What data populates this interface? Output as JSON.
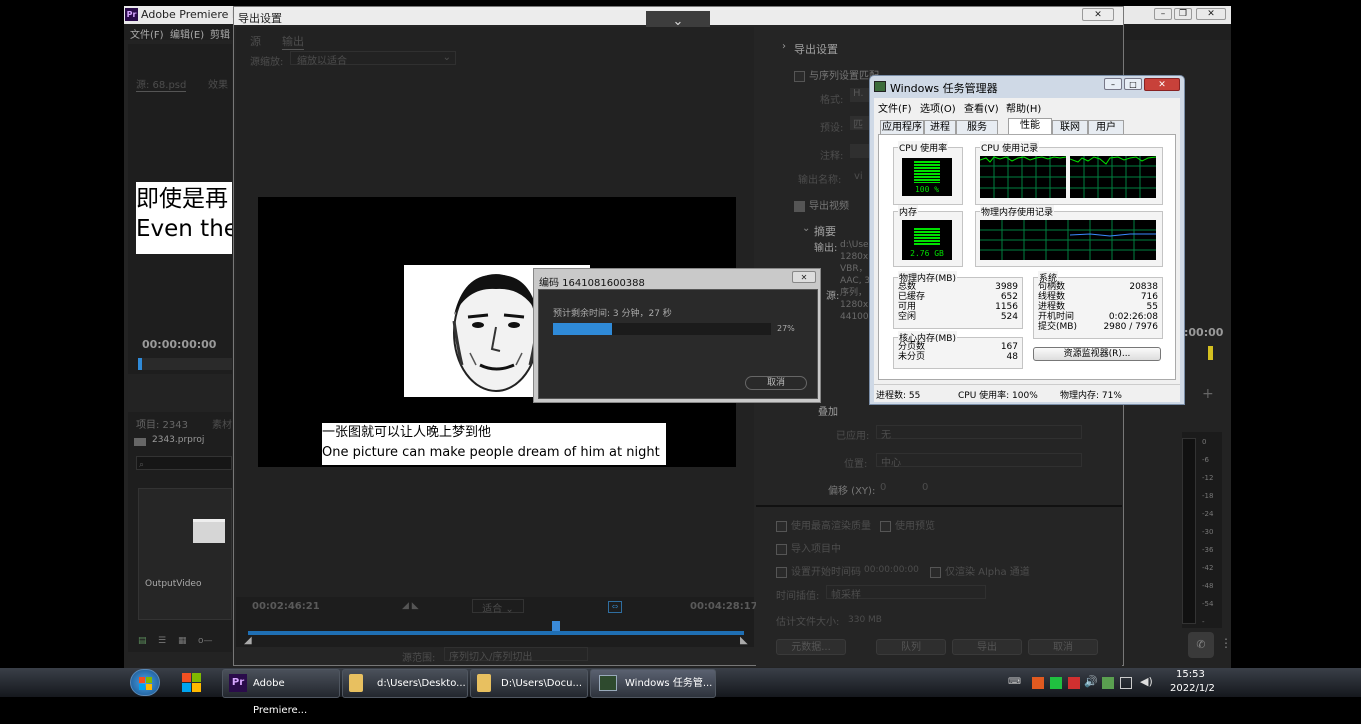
{
  "premiere": {
    "title": "Adobe Premiere Pro",
    "app_badge": "Pr",
    "menu": [
      "文件(F)",
      "编辑(E)",
      "剪辑"
    ],
    "source_tab": "源: 68.psd",
    "effects_tab": "效果",
    "subtitle_cn_fragment": "即使是再",
    "subtitle_en_fragment": "Even the",
    "timecode_left": "00:00:00:00",
    "timecode_right": ":00:00",
    "project_tab": "项目: 2343",
    "material_tab": "素材",
    "project_file": "2343.prproj",
    "output_folder": "OutputVideo",
    "meter_labels": [
      "0",
      "-6",
      "-12",
      "-18",
      "-24",
      "-30",
      "-36",
      "-42",
      "-48",
      "-54",
      "-"
    ]
  },
  "export_dialog": {
    "title": "导出设置",
    "tabs": [
      "源",
      "输出"
    ],
    "source_scaling_label": "源缩放:",
    "source_scaling_value": "缩放以适合",
    "caption_cn": "一张图就可以让人晚上梦到他",
    "caption_en": "One picture can make people dream of him at night",
    "timecode_in": "00:02:46:21",
    "timecode_out": "00:04:28:17",
    "fit_value": "适合",
    "range_label": "源范围:",
    "range_value": "序列切入/序列切出",
    "settings": {
      "heading": "导出设置",
      "match_sequence": "与序列设置匹配",
      "format_label": "格式:",
      "format_value": "H.",
      "preset_label": "预设:",
      "preset_value": "匹",
      "comment_label": "注释:",
      "output_name_label": "输出名称:",
      "output_name_value": "vi",
      "export_video": "导出视频",
      "summary_heading": "摘要",
      "output_label": "输出:",
      "output_lines": [
        "d:\\Users",
        "1280x72",
        "VBR，",
        "AAC, 32"
      ],
      "source_label": "源:",
      "source_lines": [
        "序列，",
        "1280x7",
        "44100 H"
      ],
      "overlay_heading": "叠加",
      "applied_label": "已应用:",
      "applied_value": "无",
      "position_label": "位置:",
      "position_value": "中心",
      "offset_label": "偏移 (XY):",
      "offset_x": "0",
      "offset_y": "0",
      "max_render_quality": "使用最高渲染质量",
      "use_preview": "使用预览",
      "import_into_project": "导入项目中",
      "set_start_timecode": "设置开始时间码",
      "start_timecode_value": "00:00:00:00",
      "render_alpha_only": "仅渲染 Alpha 通道",
      "time_interp_label": "时间插值:",
      "time_interp_value": "帧采样",
      "est_size_label": "估计文件大小:",
      "est_size_value": "330 MB",
      "buttons": [
        "元数据...",
        "队列",
        "导出",
        "取消"
      ]
    }
  },
  "encode_dialog": {
    "title": "编码 1641081600388",
    "remaining": "预计剩余时间: 3 分钟，27 秒",
    "progress_percent": 27,
    "progress_label": "27%",
    "cancel": "取消"
  },
  "task_manager": {
    "title": "Windows 任务管理器",
    "menu": [
      "文件(F)",
      "选项(O)",
      "查看(V)",
      "帮助(H)"
    ],
    "tabs": [
      "应用程序",
      "进程",
      "服务",
      "性能",
      "联网",
      "用户"
    ],
    "active_tab": "性能",
    "cpu_usage_label": "CPU 使用率",
    "cpu_usage_value": "100 %",
    "cpu_history_label": "CPU 使用记录",
    "memory_label": "内存",
    "memory_value": "2.76 GB",
    "memory_history_label": "物理内存使用记录",
    "physical_memory": {
      "heading": "物理内存(MB)",
      "rows": [
        [
          "总数",
          "3989"
        ],
        [
          "已缓存",
          "652"
        ],
        [
          "可用",
          "1156"
        ],
        [
          "空闲",
          "524"
        ]
      ]
    },
    "kernel_memory": {
      "heading": "核心内存(MB)",
      "rows": [
        [
          "分页数",
          "167"
        ],
        [
          "未分页",
          "48"
        ]
      ]
    },
    "system": {
      "heading": "系统",
      "rows": [
        [
          "句柄数",
          "20838"
        ],
        [
          "线程数",
          "716"
        ],
        [
          "进程数",
          "55"
        ],
        [
          "开机时间",
          "0:02:26:08"
        ],
        [
          "提交(MB)",
          "2980 / 7976"
        ]
      ]
    },
    "resource_monitor_button": "资源监视器(R)...",
    "status": {
      "processes": "进程数: 55",
      "cpu": "CPU 使用率: 100%",
      "memory": "物理内存: 71%"
    }
  },
  "taskbar": {
    "items": [
      "Adobe Premiere...",
      "d:\\Users\\Deskto...",
      "D:\\Users\\Docu...",
      "Windows 任务管..."
    ],
    "time": "15:53",
    "date": "2022/1/2"
  },
  "colors": {
    "accent_blue": "#2f8ad8",
    "graph_green": "#00d000",
    "graph_grid": "#008040",
    "dark_bg": "#232323"
  }
}
